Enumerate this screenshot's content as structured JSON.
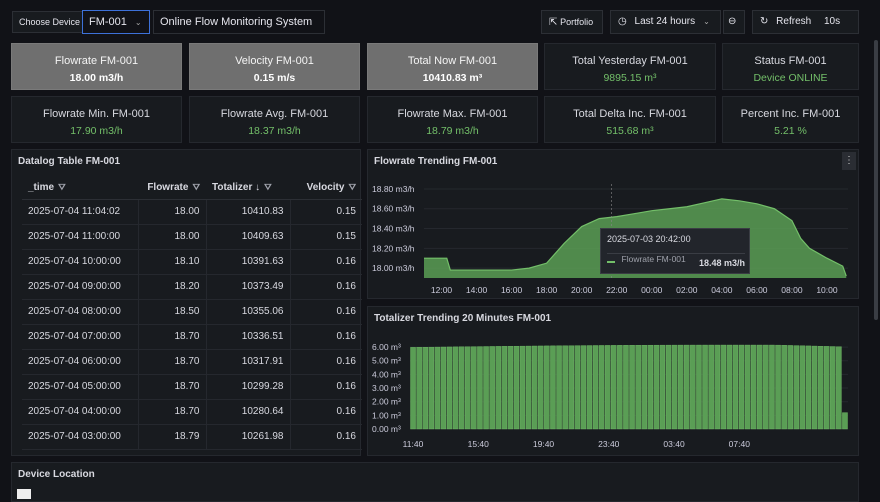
{
  "toolbar": {
    "device_label": "Choose Device",
    "device_value": "FM-001",
    "system_value": "Online Flow Monitoring System",
    "portfolio_label": "Portfolio",
    "time_range": "Last 24 hours",
    "refresh_label": "Refresh",
    "refresh_interval": "10s"
  },
  "stats_row1": [
    {
      "title": "Flowrate FM-001",
      "value": "18.00 m3/h"
    },
    {
      "title": "Velocity FM-001",
      "value": "0.15 m/s"
    },
    {
      "title": "Total Now FM-001",
      "value": "10410.83 m³"
    },
    {
      "title": "Total Yesterday FM-001",
      "value": "9895.15 m³"
    },
    {
      "title": "Status FM-001",
      "value": "Device ONLINE"
    }
  ],
  "stats_row2": [
    {
      "title": "Flowrate Min. FM-001",
      "value": "17.90 m3/h"
    },
    {
      "title": "Flowrate Avg. FM-001",
      "value": "18.37 m3/h"
    },
    {
      "title": "Flowrate Max. FM-001",
      "value": "18.79 m3/h"
    },
    {
      "title": "Total Delta Inc. FM-001",
      "value": "515.68 m³"
    },
    {
      "title": "Percent Inc. FM-001",
      "value": "5.21 %"
    }
  ],
  "datalog": {
    "title": "Datalog Table FM-001",
    "columns": [
      "_time",
      "Flowrate",
      "Totalizer",
      "Velocity"
    ],
    "sort_indicator": "↓",
    "rows": [
      [
        "2025-07-04 11:04:02",
        "18.00",
        "10410.83",
        "0.15"
      ],
      [
        "2025-07-04 11:00:00",
        "18.00",
        "10409.63",
        "0.15"
      ],
      [
        "2025-07-04 10:00:00",
        "18.10",
        "10391.63",
        "0.16"
      ],
      [
        "2025-07-04 09:00:00",
        "18.20",
        "10373.49",
        "0.16"
      ],
      [
        "2025-07-04 08:00:00",
        "18.50",
        "10355.06",
        "0.16"
      ],
      [
        "2025-07-04 07:00:00",
        "18.70",
        "10336.51",
        "0.16"
      ],
      [
        "2025-07-04 06:00:00",
        "18.70",
        "10317.91",
        "0.16"
      ],
      [
        "2025-07-04 05:00:00",
        "18.70",
        "10299.28",
        "0.16"
      ],
      [
        "2025-07-04 04:00:00",
        "18.70",
        "10280.64",
        "0.16"
      ],
      [
        "2025-07-04 03:00:00",
        "18.79",
        "10261.98",
        "0.16"
      ]
    ]
  },
  "flow_chart_title": "Flowrate Trending FM-001",
  "total_chart_title": "Totalizer Trending 20 Minutes FM-001",
  "tooltip": {
    "time": "2025-07-03 20:42:00",
    "series": "Flowrate FM-001",
    "value": "18.48 m3/h"
  },
  "location_title": "Device Location",
  "colors": {
    "accent": "#73bf69",
    "fill": "#5a9e55",
    "bg": "#111217",
    "panel": "#181b1f"
  },
  "chart_data": [
    {
      "type": "area",
      "title": "Flowrate Trending FM-001",
      "yticks": [
        "18.00 m3/h",
        "18.20 m3/h",
        "18.40 m3/h",
        "18.60 m3/h",
        "18.80 m3/h"
      ],
      "ylim": [
        17.9,
        18.85
      ],
      "xticks": [
        "12:00",
        "14:00",
        "16:00",
        "18:00",
        "20:00",
        "22:00",
        "00:00",
        "02:00",
        "04:00",
        "06:00",
        "08:00",
        "10:00"
      ],
      "x": [
        11.0,
        12.3,
        12.5,
        14.0,
        16.0,
        17.0,
        18.0,
        19.0,
        20.0,
        21.0,
        22.0,
        23.0,
        24.0,
        25.0,
        26.0,
        27.0,
        28.0,
        29.0,
        30.0,
        31.0,
        32.0,
        32.5,
        33.0,
        34.0,
        34.9,
        35.1
      ],
      "y": [
        18.1,
        18.1,
        17.98,
        17.98,
        17.98,
        18.0,
        18.05,
        18.25,
        18.42,
        18.5,
        18.52,
        18.55,
        18.58,
        18.6,
        18.62,
        18.66,
        18.7,
        18.68,
        18.65,
        18.6,
        18.48,
        18.3,
        18.2,
        18.1,
        18.02,
        17.92
      ],
      "series": [
        {
          "name": "Flowrate FM-001"
        }
      ]
    },
    {
      "type": "bar",
      "title": "Totalizer Trending 20 Minutes FM-001",
      "yticks": [
        "0.00 m³",
        "1.00 m³",
        "2.00 m³",
        "3.00 m³",
        "4.00 m³",
        "5.00 m³",
        "6.00 m³"
      ],
      "ylim": [
        0,
        6.3
      ],
      "xticks": [
        "11:40",
        "15:40",
        "19:40",
        "23:40",
        "03:40",
        "07:40"
      ],
      "bar_count": 72,
      "values_start": 5.98,
      "values_peak": 6.15,
      "last_value": 1.2
    }
  ]
}
